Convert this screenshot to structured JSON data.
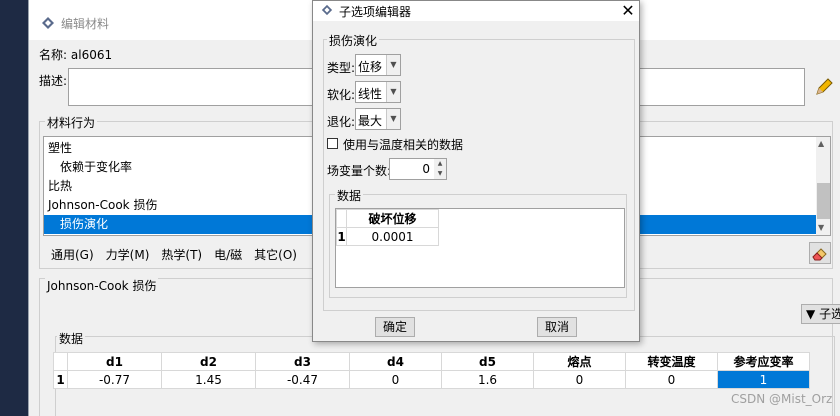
{
  "main_window": {
    "title": "编辑材料",
    "name_label": "名称:",
    "name_value": "al6061",
    "description_label": "描述:",
    "behaviors_group_label": "材料行为",
    "behaviors": [
      {
        "label": "塑性",
        "indent": false,
        "selected": false
      },
      {
        "label": "依赖于变化率",
        "indent": true,
        "selected": false
      },
      {
        "label": "比热",
        "indent": false,
        "selected": false
      },
      {
        "label": "Johnson-Cook 损伤",
        "indent": false,
        "selected": false
      },
      {
        "label": "损伤演化",
        "indent": true,
        "selected": true
      }
    ],
    "menu": {
      "general": "通用(G)",
      "mechanical": "力学(M)",
      "thermal": "热学(T)",
      "electromagnetic": "电/磁",
      "other": "其它(O)"
    },
    "section_title": "Johnson-Cook 损伤",
    "suboptions_button": "子选项",
    "data_label": "数据",
    "table": {
      "headers": [
        "d1",
        "d2",
        "d3",
        "d4",
        "d5",
        "熔点",
        "转变温度",
        "参考应变率"
      ],
      "row_label": "1",
      "row": [
        "-0.77",
        "1.45",
        "-0.47",
        "0",
        "1.6",
        "0",
        "0",
        "1"
      ]
    }
  },
  "dialog": {
    "title": "子选项编辑器",
    "group_label": "损伤演化",
    "type_label": "类型:",
    "type_value": "位移",
    "softening_label": "软化:",
    "softening_value": "线性",
    "degradation_label": "退化:",
    "degradation_value": "最大",
    "temp_checkbox_label": "使用与温度相关的数据",
    "field_vars_label": "场变量个数:",
    "field_vars_value": "0",
    "data_label": "数据",
    "table_header": "破坏位移",
    "table_row_label": "1",
    "table_value": "0.0001",
    "ok_button": "确定",
    "cancel_button": "取消"
  },
  "watermark": "CSDN @Mist_Orz",
  "colors": {
    "selection": "#0078d7",
    "window_bg": "#f0f0f0",
    "backdrop": "#1e2a44"
  }
}
